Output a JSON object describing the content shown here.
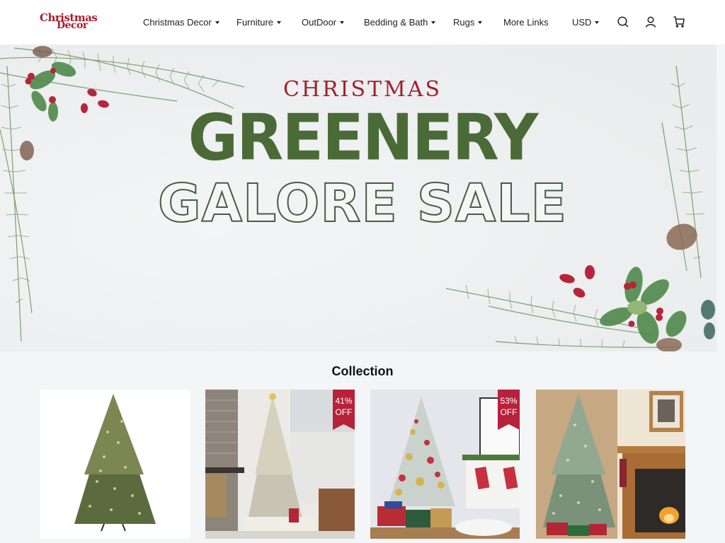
{
  "header": {
    "logo": {
      "line1": "Christmas",
      "line2": "Decor"
    },
    "nav": [
      {
        "label": "Christmas Decor",
        "has_dropdown": true
      },
      {
        "label": "Furniture",
        "has_dropdown": true
      },
      {
        "label": "OutDoor",
        "has_dropdown": true
      },
      {
        "label": "Bedding & Bath",
        "has_dropdown": true
      },
      {
        "label": "Rugs",
        "has_dropdown": true
      },
      {
        "label": "More Links",
        "has_dropdown": false
      }
    ],
    "currency": "USD",
    "icons": [
      "search-icon",
      "account-icon",
      "cart-icon"
    ]
  },
  "banner": {
    "line1": "CHRISTMAS",
    "line2": "GREENERY",
    "line3": "GALORE SALE",
    "colors": {
      "red": "#a31f2c",
      "green": "#4a6b37"
    }
  },
  "collection": {
    "title": "Collection",
    "products": [
      {
        "image": "pre-lit-christmas-tree-white-background",
        "badge": null
      },
      {
        "image": "flocked-christmas-tree-living-room",
        "badge": {
          "line1": "41%",
          "line2": "OFF"
        }
      },
      {
        "image": "decorated-flocked-tree-with-stockings",
        "badge": {
          "line1": "53%",
          "line2": "OFF"
        }
      },
      {
        "image": "christmas-tree-by-fireplace",
        "badge": null
      }
    ],
    "badge_color": "#b8213a"
  }
}
